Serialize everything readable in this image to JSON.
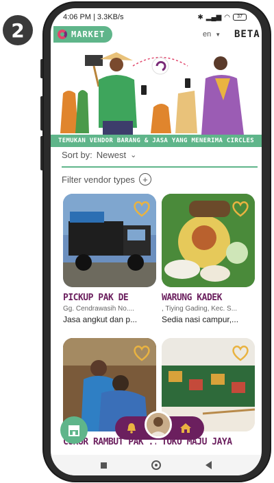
{
  "step_number": "2",
  "status_bar": {
    "time_speed": "4:06 PM | 3.3KB/s",
    "battery": "37"
  },
  "header": {
    "app_name": "MARKET",
    "language": "en",
    "beta": "BETA"
  },
  "banner_text": "TEMUKAN VENDOR BARANG & JASA YANG MENERIMA CIRCLES",
  "sort": {
    "label": "Sort by:",
    "value": "Newest"
  },
  "filter": {
    "label": "Filter vendor types"
  },
  "vendors": [
    {
      "title": "PICKUP PAK DE",
      "address": "Gg. Cendrawasih No....",
      "description": "Jasa angkut dan p..."
    },
    {
      "title": "WARUNG KADEK",
      "address": ", Tiying Gading, Kec. S...",
      "description": "Sedia nasi campur,..."
    },
    {
      "title": "CUKUR RAMBUT PAK ...",
      "address": "",
      "description": ""
    },
    {
      "title": "TOKO MAJU JAYA",
      "address": "",
      "description": ""
    }
  ],
  "colors": {
    "brand_green": "#5fb58a",
    "brand_purple": "#6b1f5e",
    "heart_gold": "#e9b341"
  },
  "icons": [
    "store-icon",
    "bell-icon",
    "home-icon",
    "heart-icon",
    "plus-icon",
    "chevron-down-icon"
  ]
}
